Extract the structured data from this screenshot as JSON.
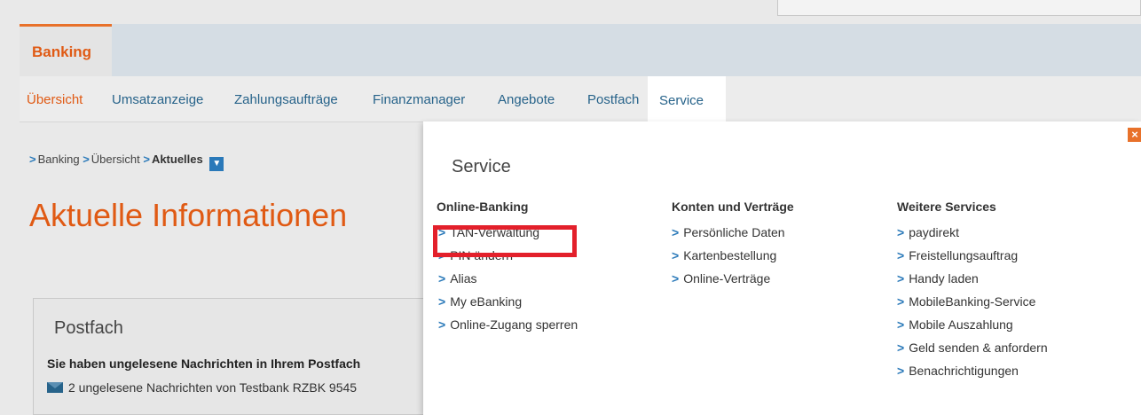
{
  "banking_tab": "Banking",
  "subnav": {
    "items": [
      "Übersicht",
      "Umsatzanzeige",
      "Zahlungsaufträge",
      "Finanzmanager",
      "Angebote",
      "Postfach"
    ],
    "service": "Service"
  },
  "breadcrumb": {
    "items": [
      "Banking",
      "Übersicht",
      "Aktuelles"
    ]
  },
  "page_title": "Aktuelle Informationen",
  "postfach": {
    "heading": "Postfach",
    "text": "Sie haben ungelesene Nachrichten in Ihrem Postfach",
    "message": "2 ungelesene Nachrichten von Testbank RZBK 9545"
  },
  "service_panel": {
    "title": "Service",
    "close": "×",
    "columns": [
      {
        "heading": "Online-Banking",
        "items": [
          "TAN-Verwaltung",
          "PIN ändern",
          "Alias",
          "My eBanking",
          "Online-Zugang sperren"
        ]
      },
      {
        "heading": "Konten und Verträge",
        "items": [
          "Persönliche Daten",
          "Kartenbestellung",
          "Online-Verträge"
        ]
      },
      {
        "heading": "Weitere Services",
        "items": [
          "paydirekt",
          "Freistellungsauftrag",
          "Handy laden",
          "MobileBanking-Service",
          "Mobile Auszahlung",
          "Geld senden & anfordern",
          "Benachrichtigungen"
        ]
      }
    ]
  },
  "colors": {
    "accent_orange": "#e05a14",
    "link_blue": "#27638a",
    "highlight_red": "#e3202b"
  }
}
